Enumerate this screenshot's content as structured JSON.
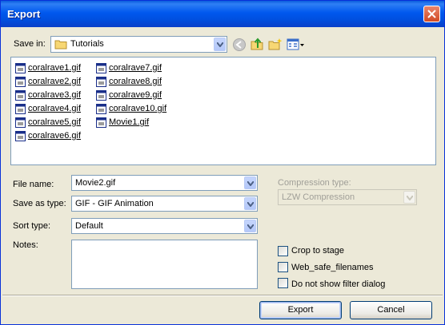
{
  "window": {
    "title": "Export"
  },
  "save_in": {
    "label": "Save in:",
    "value": "Tutorials"
  },
  "files": [
    "coralrave1.gif",
    "coralrave2.gif",
    "coralrave3.gif",
    "coralrave4.gif",
    "coralrave5.gif",
    "coralrave6.gif",
    "coralrave7.gif",
    "coralrave8.gif",
    "coralrave9.gif",
    "coralrave10.gif",
    "Movie1.gif"
  ],
  "file_name": {
    "label": "File name:",
    "value": "Movie2.gif"
  },
  "save_as_type": {
    "label": "Save as type:",
    "value": "GIF - GIF Animation"
  },
  "sort_type": {
    "label": "Sort type:",
    "value": "Default"
  },
  "notes": {
    "label": "Notes:",
    "value": ""
  },
  "compression": {
    "label": "Compression type:",
    "value": "LZW Compression"
  },
  "options": {
    "crop_to_stage": "Crop to stage",
    "web_safe": "Web_safe_filenames",
    "no_filter": "Do not show filter dialog"
  },
  "buttons": {
    "export": "Export",
    "cancel": "Cancel"
  },
  "icons": {
    "folder": "folder-icon",
    "back": "back-icon",
    "up": "up-folder-icon",
    "new_folder": "new-folder-icon",
    "views": "view-menu-icon",
    "file": "gif-file-icon"
  }
}
